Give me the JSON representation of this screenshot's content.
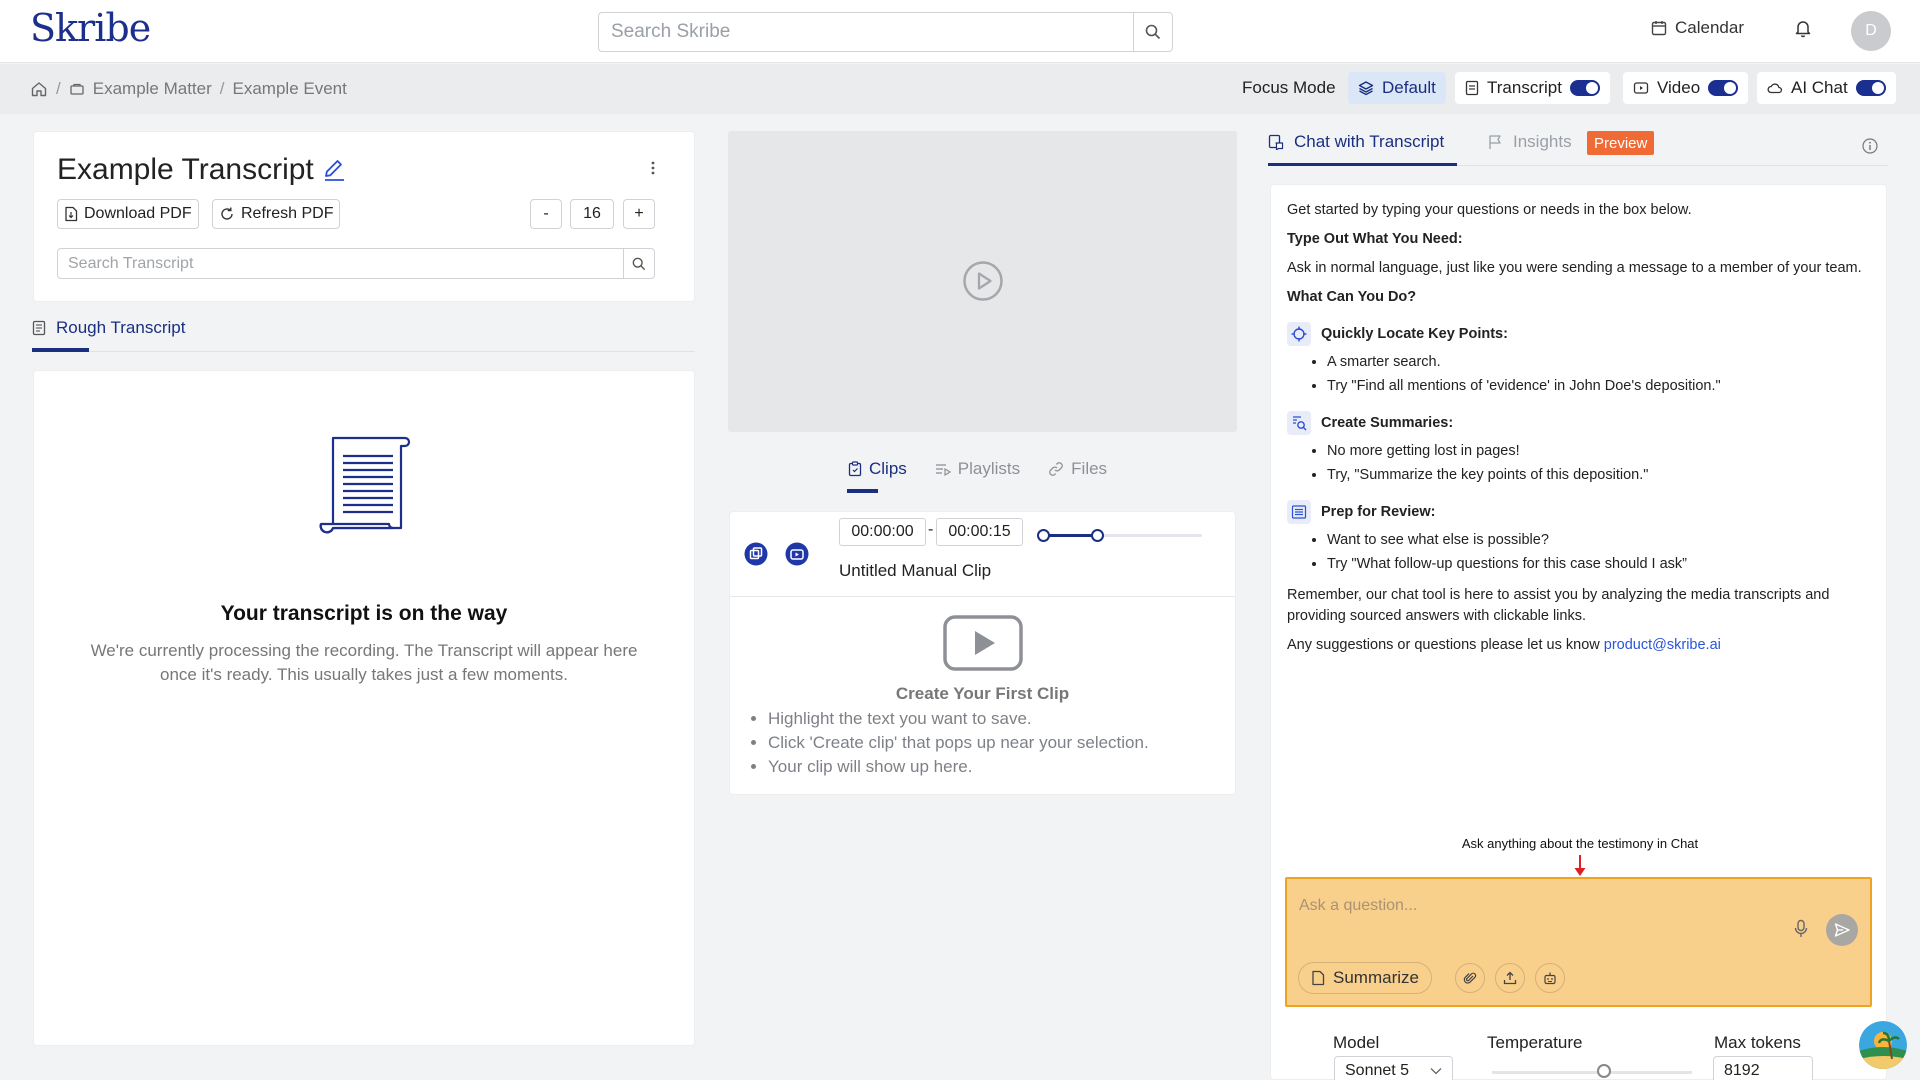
{
  "app": {
    "logo": "Skribe"
  },
  "search": {
    "placeholder": "Search Skribe"
  },
  "header": {
    "calendar_label": "Calendar",
    "avatar_initial": "D"
  },
  "breadcrumb": {
    "items": [
      "Example Matter",
      "Example Event"
    ]
  },
  "focus_mode": {
    "label": "Focus Mode",
    "options": [
      {
        "label": "Default",
        "selected": true
      },
      {
        "label": "Transcript",
        "on": true
      },
      {
        "label": "Video",
        "on": true
      },
      {
        "label": "AI Chat",
        "on": true
      }
    ]
  },
  "transcript": {
    "title": "Example Transcript",
    "download_label": "Download PDF",
    "refresh_label": "Refresh PDF",
    "minus": "-",
    "font_size": "16",
    "plus": "+",
    "search_placeholder": "Search Transcript",
    "tab_label": "Rough Transcript",
    "empty_title": "Your transcript is on the way",
    "empty_desc": "We're currently processing the recording. The Transcript will appear here once it's ready. This usually takes just a few moments."
  },
  "media": {
    "tabs": [
      "Clips",
      "Playlists",
      "Files"
    ],
    "active_tab": "Clips",
    "clip": {
      "start": "00:00:00",
      "dash": "-",
      "end": "00:00:15",
      "name": "Untitled Manual Clip"
    },
    "empty_title": "Create Your First Clip",
    "empty_steps": [
      "Highlight the text you want to save.",
      "Click 'Create clip' that pops up near your selection.",
      "Your clip will show up here."
    ]
  },
  "chat": {
    "tab_label": "Chat with Transcript",
    "insights_label": "Insights",
    "preview_badge": "Preview",
    "intro": "Get started by typing your questions or needs in the box below.",
    "type_heading": "Type Out What You Need:",
    "type_desc": "Ask in normal language, just like you were sending a message to a member of your team.",
    "what_heading": "What Can You Do?",
    "features": [
      {
        "icon": "crosshair-icon",
        "title": "Quickly Locate Key Points:",
        "bullets": [
          "A smarter search.",
          "Try \"Find all mentions of 'evidence' in John Doe's deposition.\""
        ]
      },
      {
        "icon": "search-doc-icon",
        "title": "Create Summaries:",
        "bullets": [
          "No more getting lost in pages!",
          "Try, \"Summarize the key points of this deposition.\""
        ]
      },
      {
        "icon": "list-icon",
        "title": "Prep for Review:",
        "bullets": [
          "Want to see what else is possible?",
          "Try \"What follow-up questions for this case should I ask”"
        ]
      }
    ],
    "remember": "Remember, our chat tool is here to assist you by analyzing the media transcripts and providing sourced answers with clickable links.",
    "suggest": "Any suggestions or questions please let us know ",
    "email": "product@skribe.ai",
    "annotation": "Ask anything about the testimony in Chat",
    "input_placeholder": "Ask a question...",
    "summarize_label": "Summarize",
    "model_label": "Model",
    "model_value": "Sonnet 5",
    "temperature_label": "Temperature",
    "temperature_level": 0.56,
    "max_tokens_label": "Max tokens",
    "max_tokens_value": "8192"
  },
  "colors": {
    "brand": "#1a2f80",
    "accent_orange": "#f06a35",
    "highlight_box": "#f9cf8c",
    "highlight_border": "#f0a321"
  }
}
